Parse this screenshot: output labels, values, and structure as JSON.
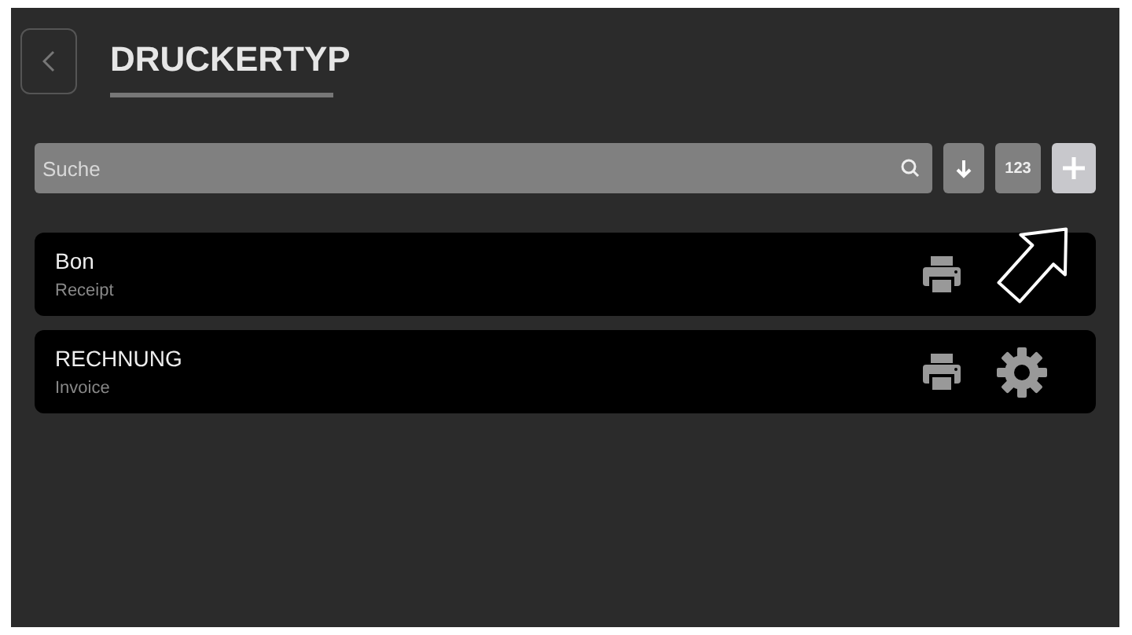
{
  "header": {
    "title": "DRUCKERTYP"
  },
  "search": {
    "placeholder": "Suche"
  },
  "toolbar": [
    {
      "kind": "sort"
    },
    {
      "kind": "numeric",
      "label": "123"
    },
    {
      "kind": "add"
    }
  ],
  "printer_types": [
    {
      "name": "Bon",
      "description": "Receipt"
    },
    {
      "name": "RECHNUNG",
      "description": "Invoice"
    }
  ]
}
